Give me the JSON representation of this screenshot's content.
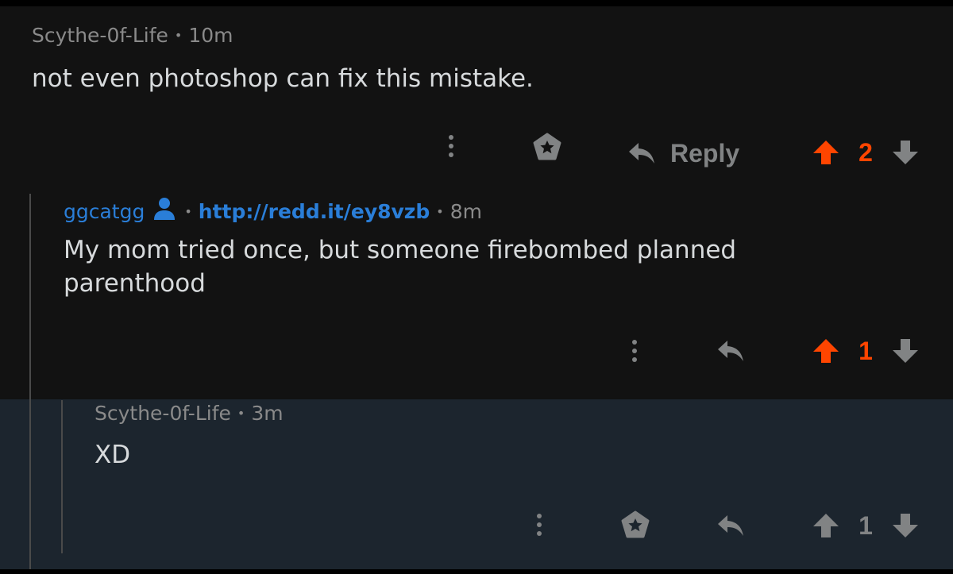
{
  "colors": {
    "background": "#121212",
    "highlight_background": "#1c252e",
    "upvoted": "#ff4500",
    "link": "#2a7ed8",
    "muted": "#818384",
    "text": "#d7dadc"
  },
  "comments": [
    {
      "author": "Scythe-0f-Life",
      "time": "10m",
      "body": "not even photoshop can fix this mistake.",
      "reply_label": "Reply",
      "score": "2",
      "vote_state": "upvoted"
    },
    {
      "author": "ggcatgg",
      "author_icon": "user-icon",
      "link": "http://redd.it/ey8vzb",
      "time": "8m",
      "body": "My mom tried once, but someone firebombed planned parenthood",
      "score": "1",
      "vote_state": "upvoted"
    },
    {
      "author": "Scythe-0f-Life",
      "time": "3m",
      "body": "XD",
      "score": "1",
      "vote_state": "none",
      "highlighted": true
    }
  ],
  "icons": {
    "more": "more-vertical-icon",
    "award": "award-icon",
    "reply": "reply-arrow-icon",
    "upvote": "upvote-arrow-icon",
    "downvote": "downvote-arrow-icon"
  }
}
